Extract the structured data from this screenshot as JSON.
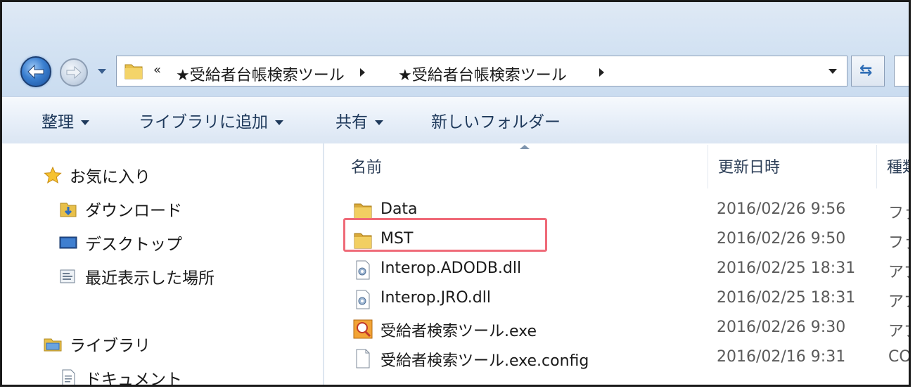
{
  "address": {
    "chevron": "«",
    "segments": [
      "★受給者台帳検索ツール",
      "★受給者台帳検索ツール"
    ]
  },
  "toolbar": {
    "organize": "整理",
    "add_to_library": "ライブラリに追加",
    "share": "共有",
    "new_folder": "新しいフォルダー"
  },
  "sidebar": {
    "favorites": "お気に入り",
    "downloads": "ダウンロード",
    "desktop": "デスクトップ",
    "recent": "最近表示した場所",
    "libraries": "ライブラリ",
    "documents": "ドキュメント"
  },
  "columns": {
    "name": "名前",
    "modified": "更新日時",
    "type": "種類"
  },
  "files": [
    {
      "name": "Data",
      "date": "2016/02/26 9:56",
      "type": "ファ",
      "icon": "folder-icon"
    },
    {
      "name": "MST",
      "date": "2016/02/26 9:50",
      "type": "ファ",
      "icon": "folder-icon"
    },
    {
      "name": "Interop.ADODB.dll",
      "date": "2016/02/25 18:31",
      "type": "アプ",
      "icon": "dll-file-icon"
    },
    {
      "name": "Interop.JRO.dll",
      "date": "2016/02/25 18:31",
      "type": "アプ",
      "icon": "dll-file-icon"
    },
    {
      "name": "受給者検索ツール.exe",
      "date": "2016/02/26 9:30",
      "type": "アプ",
      "icon": "exe-app-icon"
    },
    {
      "name": "受給者検索ツール.exe.config",
      "date": "2016/02/16 9:31",
      "type": "CON",
      "icon": "config-file-icon"
    }
  ],
  "highlight_color": "#ef6a78"
}
